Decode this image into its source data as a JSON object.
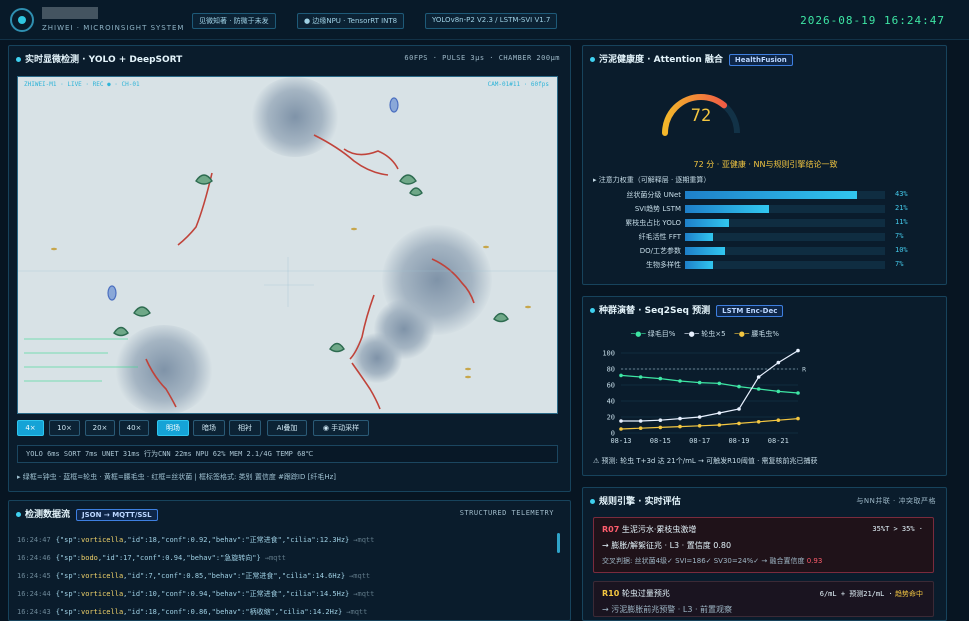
{
  "header": {
    "brand_sub": "ZHIWEI · MICROINSIGHT SYSTEM",
    "tags": [
      "见微知著 · 防微于未发",
      "● 边缘NPU · TensorRT INT8",
      "YOLOv8n-P2 V2.3 / LSTM-SVI V1.7"
    ],
    "clock": "2026-08-19 16:24:47"
  },
  "observe": {
    "title": "实时显微检测 · YOLO + DeepSORT",
    "meta": "60FPS · PULSE 3μs · CHAMBER 200μm",
    "overlay_left": "ZHIWEI-M1 · LIVE · REC ● · CH-01",
    "overlay_right": "CAM-01#11 · 60fps",
    "zoom_buttons": [
      "4×",
      "10×",
      "20×",
      "40×"
    ],
    "mode_buttons": [
      "明场",
      "暗场",
      "相衬",
      "AI叠加"
    ],
    "capture_button": "◉ 手动采样",
    "stats": "YOLO 6ms   SORT 7ms   UNET 31ms   行为CNN 22ms   NPU 62%   MEM 2.1/4G   TEMP 68℃",
    "legend": "▸ 绿框=钟虫 · 蓝框=轮虫 · 黄框=腰毛虫 · 红框=丝状菌  | 框标签格式: 类别 置信度 #跟踪ID [纤毛Hz]"
  },
  "telemetry": {
    "title": "检测数据流",
    "badge": "JSON → MQTT/SSL",
    "meta": "STRUCTURED TELEMETRY",
    "lines": [
      {
        "ts": "16:24:47",
        "sp": "vorticella",
        "body": "\"id\":18,\"conf\":0.92,\"behav\":\"正常进食\",\"cilia\":12.3Hz}",
        "note": "→mqtt"
      },
      {
        "ts": "16:24:46",
        "sp": "bodo",
        "body": "\"id\":17,\"conf\":0.94,\"behav\":\"急旋转向\"}",
        "note": "→mqtt"
      },
      {
        "ts": "16:24:45",
        "sp": "vorticella",
        "body": "\"id\":7,\"conf\":0.85,\"behav\":\"正常进食\",\"cilia\":14.6Hz}",
        "note": "→mqtt"
      },
      {
        "ts": "16:24:44",
        "sp": "vorticella",
        "body": "\"id\":10,\"conf\":0.94,\"behav\":\"正常进食\",\"cilia\":14.5Hz}",
        "note": "→mqtt"
      },
      {
        "ts": "16:24:43",
        "sp": "vorticella",
        "body": "\"id\":18,\"conf\":0.86,\"behav\":\"柄收缩\",\"cilia\":14.2Hz}",
        "note": "→mqtt"
      }
    ]
  },
  "health": {
    "title": "污泥健康度 · Attention 融合",
    "badge": "HealthFusion",
    "score": 72,
    "score_max": 100,
    "summary": "72 分 · 亚健康 · NN与规则引擎结论一致",
    "weights_title": "▸ 注意力权重（可解释层 · 逐期重算）",
    "weights": [
      {
        "label": "丝状菌分级 UNet",
        "pct": 43,
        "text": "43%"
      },
      {
        "label": "SVI趋势 LSTM",
        "pct": 21,
        "text": "21%"
      },
      {
        "label": "累枝虫占比 YOLO",
        "pct": 11,
        "text": "11%"
      },
      {
        "label": "纤毛活性 FFT",
        "pct": 7,
        "text": "7%"
      },
      {
        "label": "DO/工艺参数",
        "pct": 10,
        "text": "10%"
      },
      {
        "label": "生物多样性",
        "pct": 7,
        "text": "7%"
      }
    ]
  },
  "forecast": {
    "title": "种群演替 · Seq2Seq 预测",
    "badge": "LSTM Enc-Dec",
    "warning": "⚠ 预测: 轮虫 T+3d 达 21个/mL → 可触发R10阈值 · 需复核前兆已捕获"
  },
  "chart_data": {
    "type": "line",
    "categories": [
      "08-13",
      "08-15",
      "08-17",
      "08-19",
      "08-21"
    ],
    "x": [
      "08-13",
      "08-14",
      "08-15",
      "08-16",
      "08-17",
      "08-18",
      "08-19",
      "08-20",
      "08-21",
      "08-22"
    ],
    "ylim": [
      0,
      100
    ],
    "yticks": [
      0,
      20,
      40,
      60,
      80,
      100
    ],
    "threshold": 80,
    "threshold_label": "R",
    "series": [
      {
        "name": "绿毛目%",
        "color": "#3ee6a4",
        "values": [
          72,
          70,
          68,
          65,
          63,
          62,
          58,
          55,
          52,
          50
        ]
      },
      {
        "name": "轮虫×5",
        "color": "#e8f1ff",
        "values": [
          15,
          15,
          16,
          18,
          20,
          25,
          30,
          70,
          88,
          103
        ]
      },
      {
        "name": "腰毛虫%",
        "color": "#f3c641",
        "values": [
          5,
          6,
          7,
          8,
          9,
          10,
          12,
          14,
          16,
          18
        ]
      }
    ]
  },
  "rules": {
    "title": "规则引擎 · 实时评估",
    "meta": "与NN并联 · 冲突取严格",
    "items": [
      {
        "id": "R07",
        "head": "生泥污水·累枝虫激增",
        "value": "35%T > 35% ·",
        "line2": "→ 膨胀/解絮征兆 · L3 · 置信度 0.80",
        "line3": "交叉判据: 丝状菌4级✓ SVI=186✓ SV30=24%✓ → 融合置信度",
        "conf": "0.93"
      },
      {
        "id": "R10",
        "head": "轮虫过量预兆",
        "value": "6/mL + 预测21/mL ·",
        "status": "趋势命中",
        "line2": "→ 污泥膨胀前兆预警 · L3 · 前置观察"
      }
    ]
  }
}
